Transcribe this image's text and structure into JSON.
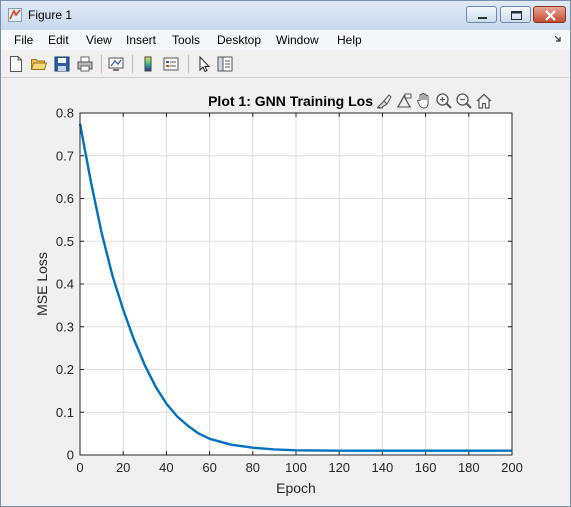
{
  "window": {
    "title": "Figure 1"
  },
  "menu": [
    "File",
    "Edit",
    "View",
    "Insert",
    "Tools",
    "Desktop",
    "Window",
    "Help"
  ],
  "icons": {
    "app": "matlab-figure-icon",
    "toolbar": [
      "new-figure-icon",
      "open-icon",
      "save-icon",
      "print-icon",
      "link-plot-icon",
      "colorbar-icon",
      "legend-icon",
      "select-pointer-icon",
      "property-editor-icon"
    ],
    "axes_toolbar": [
      "brush-icon",
      "data-tips-icon",
      "pan-icon",
      "zoom-in-icon",
      "zoom-out-icon",
      "home-icon"
    ]
  },
  "colors": {
    "line": "#0072bd",
    "grid": "#dedede",
    "axes_bg": "#ffffff",
    "figure_bg": "#f0f0f0"
  },
  "chart_data": {
    "type": "line",
    "title": "Plot 1: GNN Training Los",
    "xlabel": "Epoch",
    "ylabel": "MSE Loss",
    "xlim": [
      0,
      200
    ],
    "ylim": [
      0,
      0.8
    ],
    "xticks": [
      0,
      20,
      40,
      60,
      80,
      100,
      120,
      140,
      160,
      180,
      200
    ],
    "yticks": [
      0,
      0.1,
      0.2,
      0.3,
      0.4,
      0.5,
      0.6,
      0.7,
      0.8
    ],
    "ytick_labels": [
      "0",
      "0.1",
      "0.2",
      "0.3",
      "0.4",
      "0.5",
      "0.6",
      "0.7",
      "0.8"
    ],
    "grid": true,
    "series": [
      {
        "x": [
          0,
          5,
          10,
          15,
          20,
          25,
          30,
          35,
          40,
          45,
          50,
          55,
          60,
          70,
          80,
          90,
          100,
          120,
          140,
          160,
          180,
          200
        ],
        "y": [
          0.775,
          0.64,
          0.52,
          0.42,
          0.34,
          0.27,
          0.21,
          0.16,
          0.12,
          0.09,
          0.068,
          0.05,
          0.038,
          0.024,
          0.017,
          0.013,
          0.011,
          0.01,
          0.01,
          0.01,
          0.01,
          0.01
        ]
      }
    ]
  }
}
